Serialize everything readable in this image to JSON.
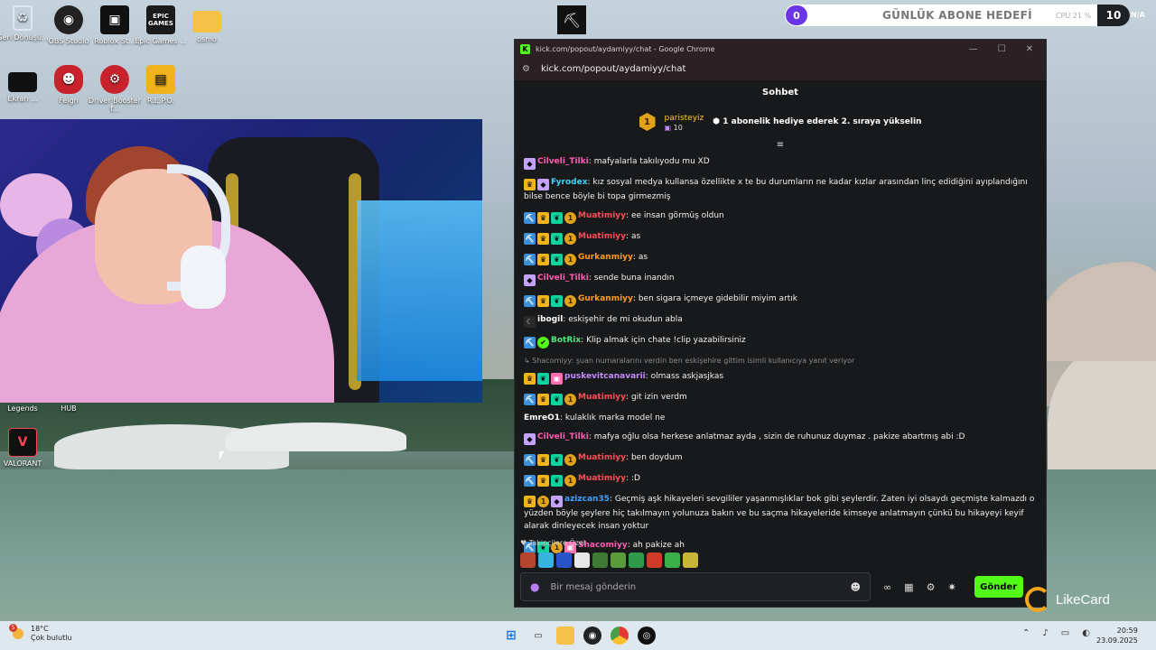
{
  "desktop": {
    "icons": [
      {
        "label": "Geri Dönüşü...",
        "icon": "recycle-bin-icon"
      },
      {
        "label": "OBS Studio",
        "icon": "obs-icon"
      },
      {
        "label": "Roblox St...",
        "icon": "roblox-icon"
      },
      {
        "label": "Epic Games ...",
        "icon": "epic-games-icon"
      },
      {
        "label": "osmo",
        "icon": "folder-icon"
      },
      {
        "label": "Ekran ...",
        "icon": "screen-icon"
      },
      {
        "label": "Feign",
        "icon": "feign-icon"
      },
      {
        "label": "Driver Booster f...",
        "icon": "driver-booster-icon"
      },
      {
        "label": "R.E.P.O.",
        "icon": "repo-icon"
      },
      {
        "label": "Legends",
        "icon": "legends-icon"
      },
      {
        "label": "HUB",
        "icon": "hub-icon"
      },
      {
        "label": "VALORANT",
        "icon": "valorant-icon"
      }
    ],
    "epic_badge": "EPIC GAMES"
  },
  "overlay": {
    "sub_goal_count": "0",
    "sub_goal_label": "GÜNLÜK ABONE HEDEFİ",
    "cpu_label": "CPU 21 %",
    "sub_goal_target": "10",
    "na_label": "N/A",
    "watermark": "LikeCard"
  },
  "browser": {
    "title": "kick.com/popout/aydamiyy/chat - Google Chrome",
    "url": "kick.com/popout/aydamiyy/chat",
    "logo": "K"
  },
  "chat": {
    "header": "Sohbet",
    "pinned": {
      "rank": "1",
      "user": "paristeyiz",
      "count": "10",
      "text": "1 abonelik hediye ederek 2. sıraya yükselin"
    },
    "messages": [
      {
        "badges": [
          "fox"
        ],
        "user": "Cilveli_Tilki",
        "color": "pink",
        "text": "mafyalarla takılıyodu mu XD"
      },
      {
        "badges": [
          "crown",
          "fox"
        ],
        "user": "Fyrodex",
        "color": "teal",
        "text": "kız sosyal medya kullansa özellikte x te bu durumların ne kadar kızlar arasından linç edidiğini ayıplandığını bilse bence böyle bi topa girmezmiş"
      },
      {
        "badges": [
          "pick",
          "crown",
          "plant",
          "sub"
        ],
        "user": "Muatimiyy",
        "color": "red",
        "text": "ee insan görmüş oldun"
      },
      {
        "badges": [
          "pick",
          "crown",
          "plant",
          "sub"
        ],
        "user": "Muatimiyy",
        "color": "red",
        "text": "as"
      },
      {
        "badges": [
          "pick",
          "crown",
          "plant",
          "sub"
        ],
        "user": "Gurkanmiyy",
        "color": "orange",
        "text": "as"
      },
      {
        "badges": [
          "fox"
        ],
        "user": "Cilveli_Tilki",
        "color": "pink",
        "text": "sende buna inandın"
      },
      {
        "badges": [
          "pick",
          "crown",
          "plant",
          "sub"
        ],
        "user": "Gurkanmiyy",
        "color": "orange",
        "text": "ben sigara içmeye gidebilir miyim artık"
      },
      {
        "badges": [
          "moon"
        ],
        "user": "ibogil",
        "color": "white",
        "text": "eskişehir de mi okudun abla"
      },
      {
        "badges": [
          "pick",
          "check"
        ],
        "user": "BotRix",
        "color": "green",
        "text": "Klip almak için chate !clip yazabilirsiniz"
      },
      {
        "reply": "↳ Shacomiyy: şuan numaralarını verdin ben eskişehire gittim isimli kullanıcıya yanıt veriyor",
        "badges": [
          "crown",
          "plant",
          "gift"
        ],
        "user": "puskevitcanavarii",
        "color": "lav",
        "text": "olmass askjasjkas"
      },
      {
        "badges": [
          "pick",
          "crown",
          "plant",
          "sub"
        ],
        "user": "Muatimiyy",
        "color": "red",
        "text": "git izin verdm"
      },
      {
        "badges": [],
        "user": "EmreO1",
        "color": "white",
        "text": "kulaklık marka model ne"
      },
      {
        "badges": [
          "fox"
        ],
        "user": "Cilveli_Tilki",
        "color": "pink",
        "text": "mafya oğlu olsa herkese anlatmaz ayda , sizin de ruhunuz duymaz . pakize abartmış abi :D"
      },
      {
        "badges": [
          "pick",
          "crown",
          "plant",
          "sub"
        ],
        "user": "Muatimiyy",
        "color": "red",
        "text": "ben doydum"
      },
      {
        "badges": [
          "pick",
          "crown",
          "plant",
          "sub"
        ],
        "user": "Muatimiyy",
        "color": "red",
        "text": ":D"
      },
      {
        "badges": [
          "crown",
          "sub",
          "fox"
        ],
        "user": "azizcan35",
        "color": "blue",
        "text": "Geçmiş aşk hikayeleri sevgililer yaşanmışlıklar bok gibi şeylerdir. Zaten iyi olsaydı geçmişte kalmazdı o yüzden böyle şeylere hiç takılmayın yolunuza bakın ve bu saçma hikayeleride kimseye anlatmayın çünkü bu hikayeyi keyif alarak dinleyecek insan yoktur"
      },
      {
        "badges": [
          "pick",
          "plant",
          "sub",
          "gift"
        ],
        "user": "Shacomiyy",
        "color": "pink",
        "text": "ah pakize ah"
      }
    ],
    "followers_only": "♥ Takipçilere Özel",
    "input_placeholder": "Bir mesaj gönderin",
    "send_label": "Gönder",
    "emote_colors": [
      "#b5452f",
      "#36b3e0",
      "#2a55c9",
      "#e8e8e8",
      "#3f7a35",
      "#5a9c3a",
      "#2f9a4a",
      "#d03a2a",
      "#3bb04a",
      "#c7b53a"
    ]
  },
  "taskbar": {
    "notif_count": "5",
    "temp": "18°C",
    "weather": "Çok bulutlu",
    "time": "20:59",
    "date": "23.09.2025"
  }
}
